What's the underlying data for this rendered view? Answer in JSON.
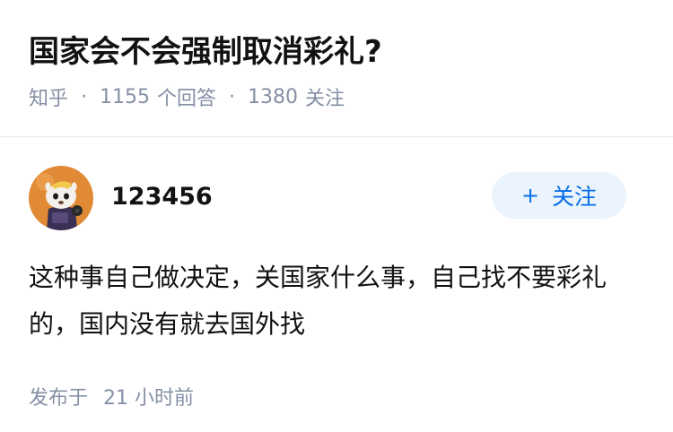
{
  "question": {
    "title": "国家会不会强制取消彩礼?",
    "source": "知乎",
    "answers_count": "1155",
    "answers_label": "个回答",
    "followers_count": "1380",
    "followers_label": "关注",
    "separator": "·"
  },
  "answer": {
    "author_name": "123456",
    "follow_button": {
      "plus": "+",
      "label": "关注"
    },
    "content": "这种事自己做决定，关国家什么事，自己找不要彩礼的，国内没有就去国外找",
    "publish_label": "发布于",
    "publish_time": "21 小时前"
  },
  "colors": {
    "meta_gray": "#8590a6",
    "accent_blue": "#056de8",
    "follow_bg": "#ebf3fc",
    "avatar_bg": "#e08a35"
  }
}
